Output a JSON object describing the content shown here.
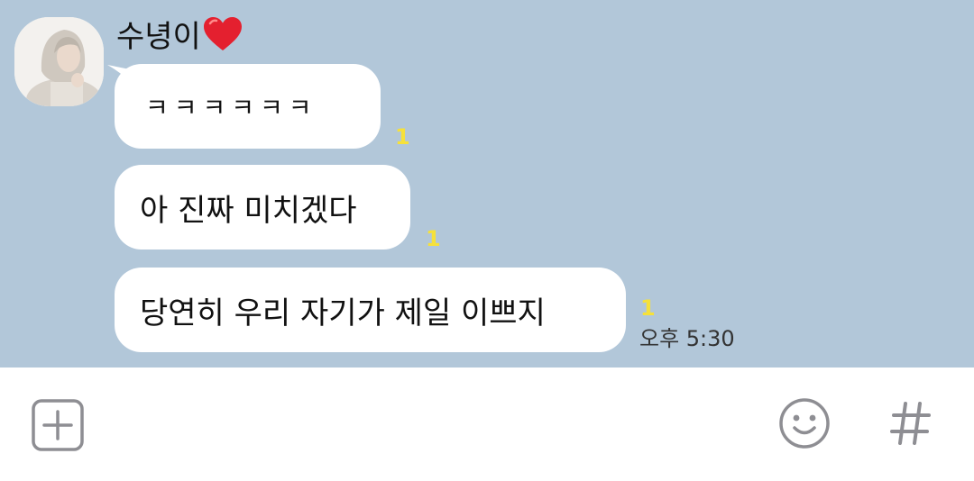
{
  "chat": {
    "sender_name": "수녕이",
    "messages": [
      {
        "text": "ㅋㅋㅋㅋㅋㅋ",
        "unread": "1"
      },
      {
        "text": "아 진짜 미치겠다",
        "unread": "1"
      },
      {
        "text": "당연히 우리 자기가 제일 이쁘지",
        "unread": "1"
      }
    ],
    "timestamp": "오후 5:30"
  },
  "colors": {
    "chat_background": "#b2c7d9",
    "bubble": "#ffffff",
    "unread_count": "#f6e13a",
    "heart": "#e4202f",
    "icon_gray": "#8e8e93"
  },
  "icons": {
    "name_suffix": "heart-icon",
    "avatar": "profile-photo",
    "add": "plus-square-icon",
    "emoji": "smiley-icon",
    "hashtag": "hash-icon"
  }
}
